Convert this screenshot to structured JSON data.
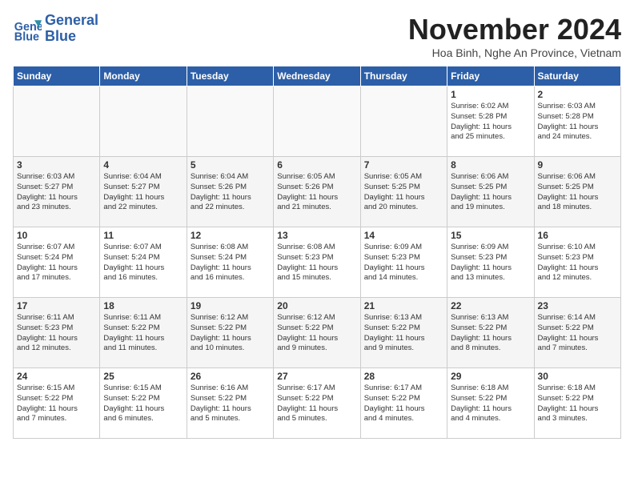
{
  "header": {
    "logo_line1": "General",
    "logo_line2": "Blue",
    "month_title": "November 2024",
    "location": "Hoa Binh, Nghe An Province, Vietnam"
  },
  "weekdays": [
    "Sunday",
    "Monday",
    "Tuesday",
    "Wednesday",
    "Thursday",
    "Friday",
    "Saturday"
  ],
  "weeks": [
    [
      {
        "day": "",
        "info": ""
      },
      {
        "day": "",
        "info": ""
      },
      {
        "day": "",
        "info": ""
      },
      {
        "day": "",
        "info": ""
      },
      {
        "day": "",
        "info": ""
      },
      {
        "day": "1",
        "info": "Sunrise: 6:02 AM\nSunset: 5:28 PM\nDaylight: 11 hours\nand 25 minutes."
      },
      {
        "day": "2",
        "info": "Sunrise: 6:03 AM\nSunset: 5:28 PM\nDaylight: 11 hours\nand 24 minutes."
      }
    ],
    [
      {
        "day": "3",
        "info": "Sunrise: 6:03 AM\nSunset: 5:27 PM\nDaylight: 11 hours\nand 23 minutes."
      },
      {
        "day": "4",
        "info": "Sunrise: 6:04 AM\nSunset: 5:27 PM\nDaylight: 11 hours\nand 22 minutes."
      },
      {
        "day": "5",
        "info": "Sunrise: 6:04 AM\nSunset: 5:26 PM\nDaylight: 11 hours\nand 22 minutes."
      },
      {
        "day": "6",
        "info": "Sunrise: 6:05 AM\nSunset: 5:26 PM\nDaylight: 11 hours\nand 21 minutes."
      },
      {
        "day": "7",
        "info": "Sunrise: 6:05 AM\nSunset: 5:25 PM\nDaylight: 11 hours\nand 20 minutes."
      },
      {
        "day": "8",
        "info": "Sunrise: 6:06 AM\nSunset: 5:25 PM\nDaylight: 11 hours\nand 19 minutes."
      },
      {
        "day": "9",
        "info": "Sunrise: 6:06 AM\nSunset: 5:25 PM\nDaylight: 11 hours\nand 18 minutes."
      }
    ],
    [
      {
        "day": "10",
        "info": "Sunrise: 6:07 AM\nSunset: 5:24 PM\nDaylight: 11 hours\nand 17 minutes."
      },
      {
        "day": "11",
        "info": "Sunrise: 6:07 AM\nSunset: 5:24 PM\nDaylight: 11 hours\nand 16 minutes."
      },
      {
        "day": "12",
        "info": "Sunrise: 6:08 AM\nSunset: 5:24 PM\nDaylight: 11 hours\nand 16 minutes."
      },
      {
        "day": "13",
        "info": "Sunrise: 6:08 AM\nSunset: 5:23 PM\nDaylight: 11 hours\nand 15 minutes."
      },
      {
        "day": "14",
        "info": "Sunrise: 6:09 AM\nSunset: 5:23 PM\nDaylight: 11 hours\nand 14 minutes."
      },
      {
        "day": "15",
        "info": "Sunrise: 6:09 AM\nSunset: 5:23 PM\nDaylight: 11 hours\nand 13 minutes."
      },
      {
        "day": "16",
        "info": "Sunrise: 6:10 AM\nSunset: 5:23 PM\nDaylight: 11 hours\nand 12 minutes."
      }
    ],
    [
      {
        "day": "17",
        "info": "Sunrise: 6:11 AM\nSunset: 5:23 PM\nDaylight: 11 hours\nand 12 minutes."
      },
      {
        "day": "18",
        "info": "Sunrise: 6:11 AM\nSunset: 5:22 PM\nDaylight: 11 hours\nand 11 minutes."
      },
      {
        "day": "19",
        "info": "Sunrise: 6:12 AM\nSunset: 5:22 PM\nDaylight: 11 hours\nand 10 minutes."
      },
      {
        "day": "20",
        "info": "Sunrise: 6:12 AM\nSunset: 5:22 PM\nDaylight: 11 hours\nand 9 minutes."
      },
      {
        "day": "21",
        "info": "Sunrise: 6:13 AM\nSunset: 5:22 PM\nDaylight: 11 hours\nand 9 minutes."
      },
      {
        "day": "22",
        "info": "Sunrise: 6:13 AM\nSunset: 5:22 PM\nDaylight: 11 hours\nand 8 minutes."
      },
      {
        "day": "23",
        "info": "Sunrise: 6:14 AM\nSunset: 5:22 PM\nDaylight: 11 hours\nand 7 minutes."
      }
    ],
    [
      {
        "day": "24",
        "info": "Sunrise: 6:15 AM\nSunset: 5:22 PM\nDaylight: 11 hours\nand 7 minutes."
      },
      {
        "day": "25",
        "info": "Sunrise: 6:15 AM\nSunset: 5:22 PM\nDaylight: 11 hours\nand 6 minutes."
      },
      {
        "day": "26",
        "info": "Sunrise: 6:16 AM\nSunset: 5:22 PM\nDaylight: 11 hours\nand 5 minutes."
      },
      {
        "day": "27",
        "info": "Sunrise: 6:17 AM\nSunset: 5:22 PM\nDaylight: 11 hours\nand 5 minutes."
      },
      {
        "day": "28",
        "info": "Sunrise: 6:17 AM\nSunset: 5:22 PM\nDaylight: 11 hours\nand 4 minutes."
      },
      {
        "day": "29",
        "info": "Sunrise: 6:18 AM\nSunset: 5:22 PM\nDaylight: 11 hours\nand 4 minutes."
      },
      {
        "day": "30",
        "info": "Sunrise: 6:18 AM\nSunset: 5:22 PM\nDaylight: 11 hours\nand 3 minutes."
      }
    ]
  ]
}
